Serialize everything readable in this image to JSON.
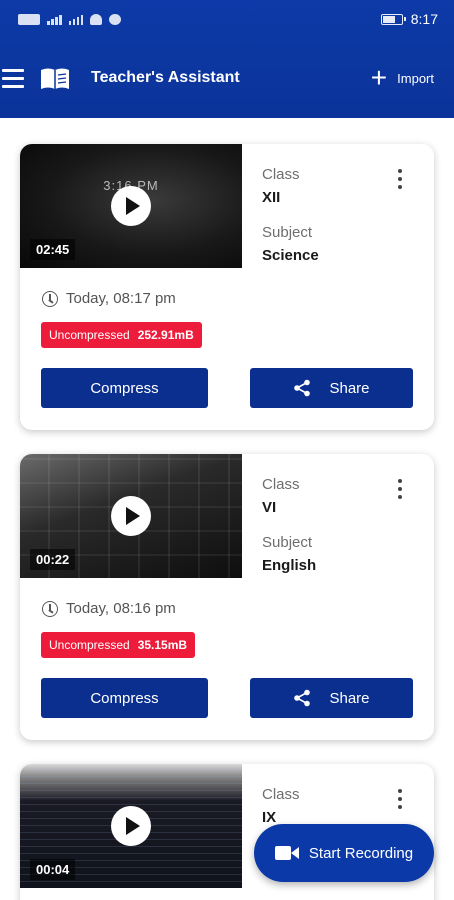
{
  "status_bar": {
    "time": "8:17"
  },
  "app_bar": {
    "title": "Teacher's Assistant",
    "import_label": "Import"
  },
  "cards": [
    {
      "thumbnail_time": "3:16 PM",
      "duration": "02:45",
      "class_label": "Class",
      "class_value": "XII",
      "subject_label": "Subject",
      "subject_value": "Science",
      "date": "Today, 08:17 pm",
      "status": "Uncompressed",
      "size": "252.91mB",
      "compress_label": "Compress",
      "share_label": "Share"
    },
    {
      "duration": "00:22",
      "class_label": "Class",
      "class_value": "VI",
      "subject_label": "Subject",
      "subject_value": "English",
      "date": "Today, 08:16 pm",
      "status": "Uncompressed",
      "size": "35.15mB",
      "compress_label": "Compress",
      "share_label": "Share"
    },
    {
      "duration": "00:04",
      "class_label": "Class",
      "class_value": "IX"
    }
  ],
  "fab": {
    "label": "Start Recording"
  },
  "colors": {
    "primary": "#0b3aa8",
    "button": "#0a2f8f",
    "badge": "#ee1c3b"
  }
}
